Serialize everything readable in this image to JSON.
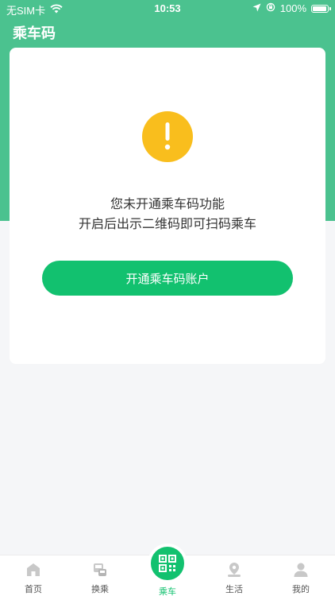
{
  "status_bar": {
    "carrier": "无SIM卡",
    "time": "10:53",
    "battery": "100%",
    "icons": [
      "wifi-icon",
      "location-arrow-icon",
      "orientation-lock-icon",
      "battery-icon"
    ]
  },
  "header": {
    "title": "乘车码"
  },
  "card": {
    "icon": "exclamation-icon",
    "message_line1": "您未开通乘车码功能",
    "message_line2": "开启后出示二维码即可扫码乘车",
    "button_label": "开通乘车码账户"
  },
  "tab_bar": {
    "items": [
      {
        "label": "首页",
        "icon": "home-icon"
      },
      {
        "label": "换乘",
        "icon": "bus-transfer-icon"
      },
      {
        "label": "乘车",
        "icon": "qr-code-icon",
        "active": true
      },
      {
        "label": "生活",
        "icon": "location-pin-icon"
      },
      {
        "label": "我的",
        "icon": "user-icon"
      }
    ]
  },
  "colors": {
    "header_green": "#4bc28f",
    "accent_green": "#12c16f",
    "warning_yellow": "#f9be1d",
    "tab_icon_gray": "#c8c8c8"
  }
}
